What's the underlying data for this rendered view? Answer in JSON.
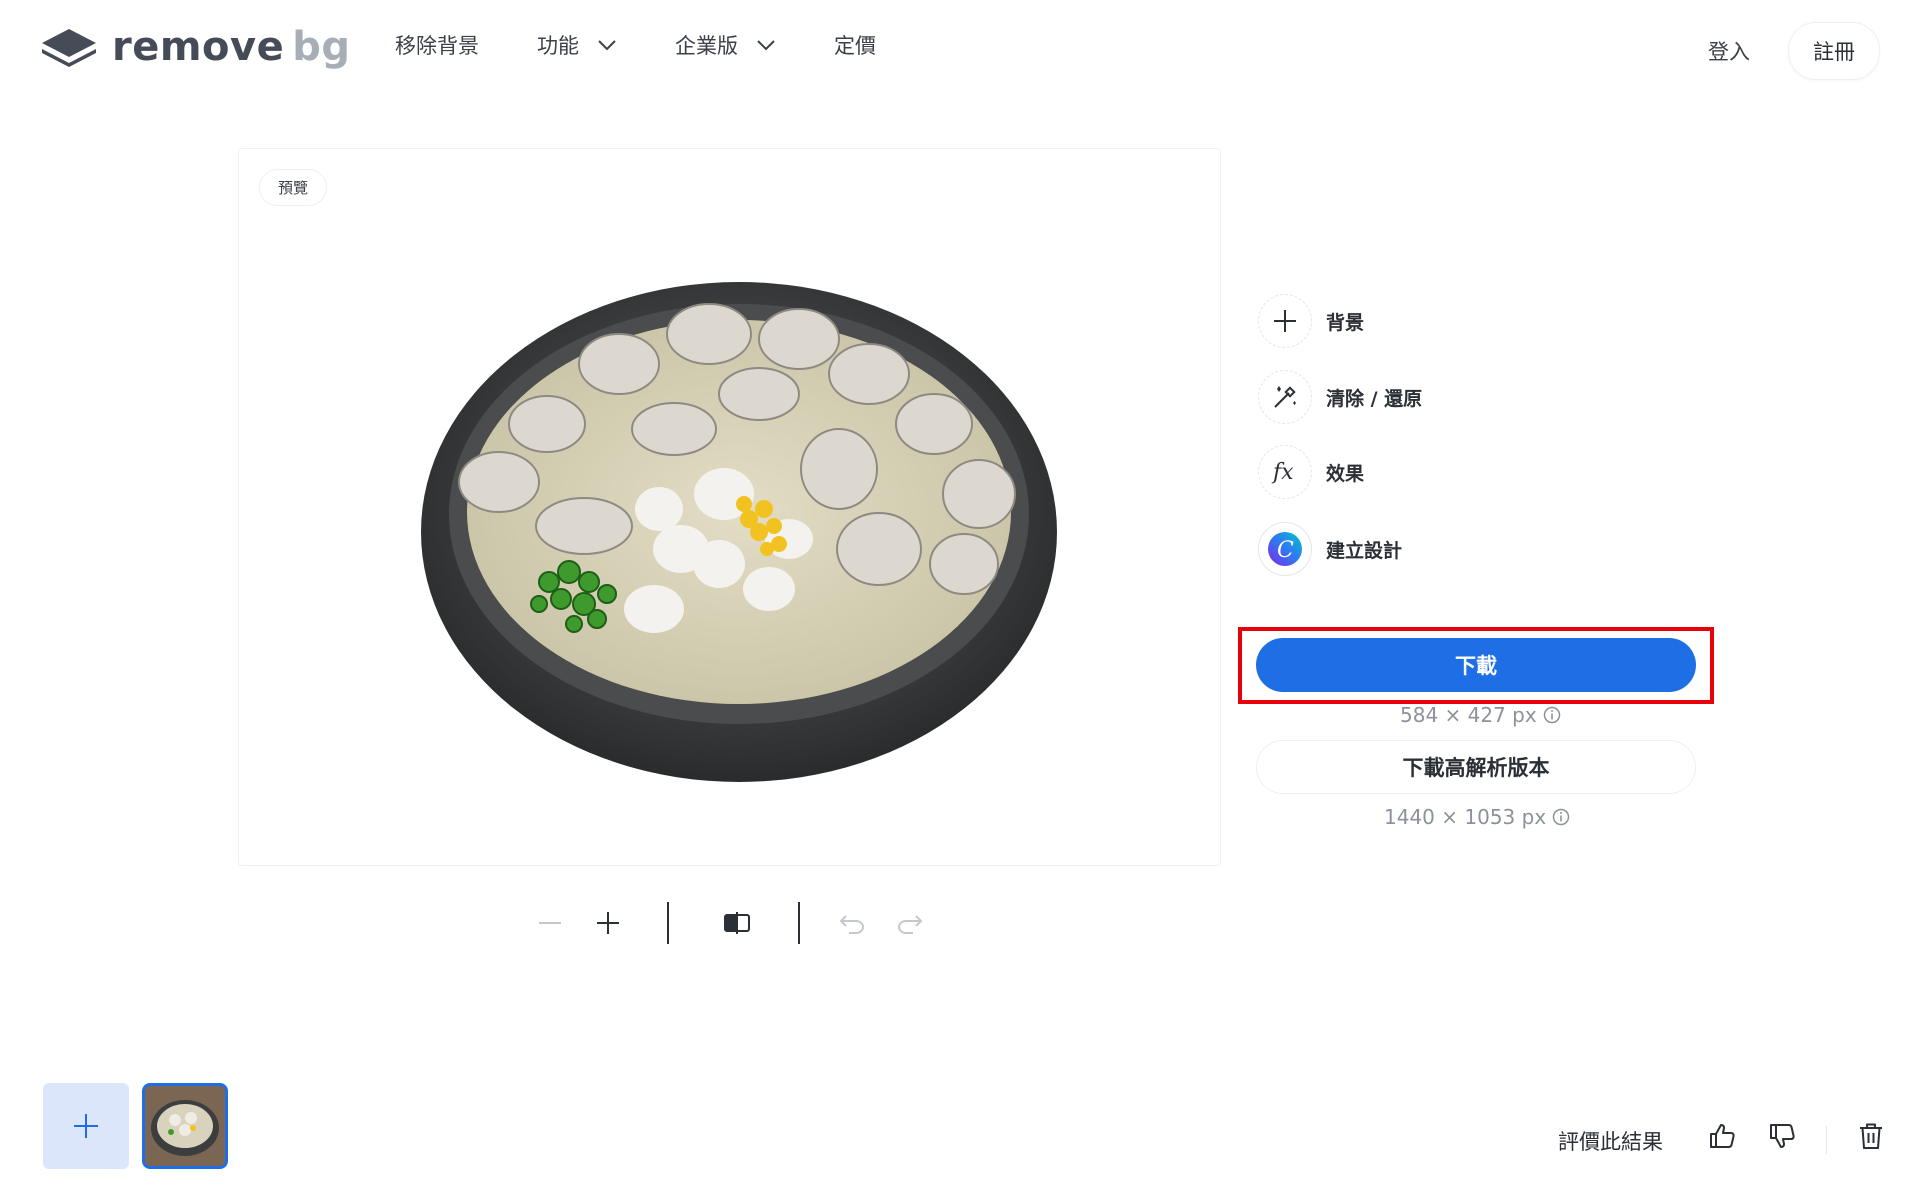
{
  "header": {
    "logo": {
      "word1": "remove",
      "word2": "bg"
    },
    "nav": [
      {
        "label": "移除背景",
        "has_dropdown": false
      },
      {
        "label": "功能",
        "has_dropdown": true
      },
      {
        "label": "企業版",
        "has_dropdown": true
      },
      {
        "label": "定價",
        "has_dropdown": false
      }
    ],
    "login": "登入",
    "signup": "註冊"
  },
  "preview": {
    "badge": "預覽",
    "image_subject": "clam porridge bowl, background removed"
  },
  "toolbar": {
    "icons": [
      "zoom-out-icon",
      "zoom-in-icon",
      "compare-icon",
      "undo-icon",
      "redo-icon"
    ]
  },
  "tools": [
    {
      "icon": "plus-icon",
      "label": "背景"
    },
    {
      "icon": "magic-wand-icon",
      "label": "清除 / 還原"
    },
    {
      "icon": "fx-icon",
      "label": "效果"
    },
    {
      "icon": "canva-icon",
      "label": "建立設計"
    }
  ],
  "download": {
    "label": "下載",
    "dimensions": "584 × 427 px",
    "hd_label": "下載高解析版本",
    "hd_dimensions": "1440 × 1053 px"
  },
  "footer": {
    "rate_label": "評價此結果"
  },
  "colors": {
    "accent": "#1e6fe6",
    "highlight_frame": "#e8000b",
    "add_tile_bg": "#dbe6fb"
  }
}
